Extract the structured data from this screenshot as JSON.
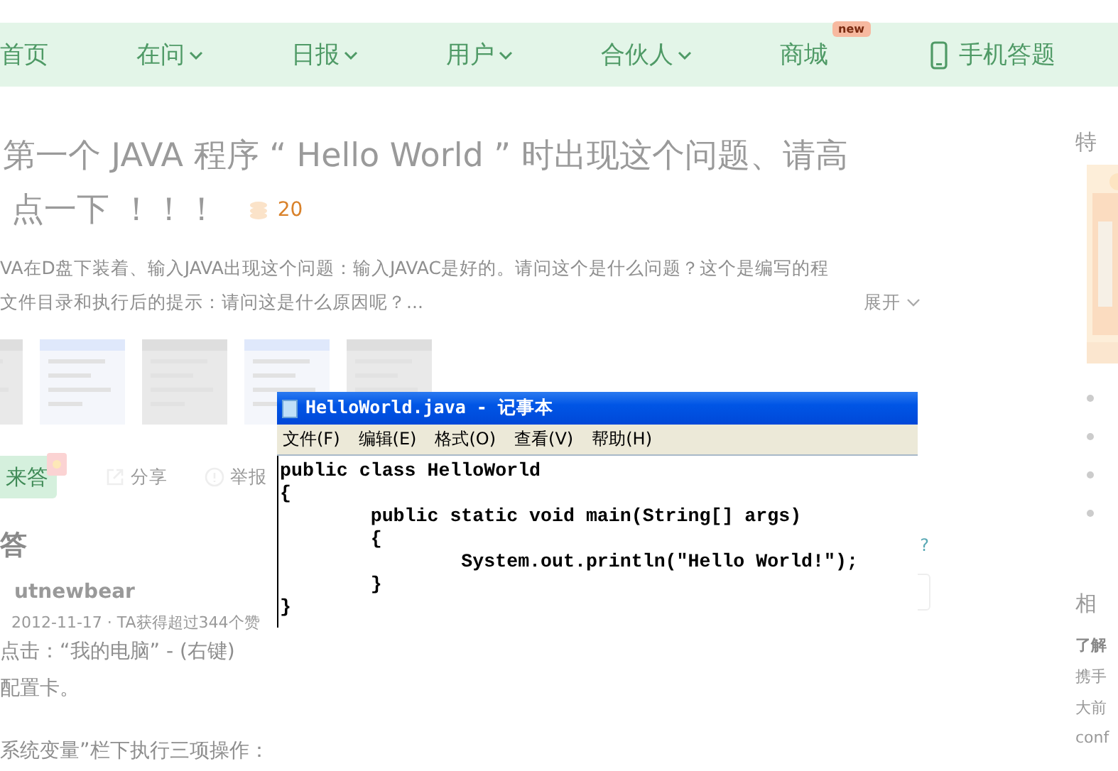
{
  "nav": {
    "items": [
      {
        "label": "首页",
        "kind": "link"
      },
      {
        "label": "在问",
        "kind": "dropdown"
      },
      {
        "label": "日报",
        "kind": "dropdown"
      },
      {
        "label": "用户",
        "kind": "dropdown"
      },
      {
        "label": "合伙人",
        "kind": "dropdown"
      },
      {
        "label": "商城",
        "kind": "badge",
        "badge": "new"
      },
      {
        "label": "手机答题",
        "kind": "app"
      }
    ]
  },
  "question": {
    "title_lines": [
      "第一个 JAVA 程序 “ Hello World ” 时出现这个问题、请高",
      "点一下 ！！！"
    ],
    "bounty": "20",
    "description_lines": [
      "VA在D盘下装着、输入JAVA出现这个问题：输入JAVAC是好的。请问这个是什么问题？这个是编写的程",
      "文件目录和执行后的提示：请问这是什么原因呢？..."
    ],
    "expand": "展开",
    "thumbnails": [
      {
        "kind": "picture"
      },
      {
        "kind": "picture"
      },
      {
        "kind": "picture"
      },
      {
        "kind": "picture"
      },
      {
        "kind": "picture"
      }
    ]
  },
  "actions": {
    "answer": "来答",
    "share": "分享",
    "report": "举报",
    "help": "?"
  },
  "answer": {
    "heading": "答",
    "author": "utnewbear",
    "meta": "2012-11-17 · TA获得超过344个赞",
    "body_lines": [
      "点击：“我的电脑” - (右键)",
      "配置卡。",
      "系统变量”栏下执行三项操作："
    ]
  },
  "sidebar": {
    "heading": "特",
    "bullets": [
      {
        "kind": "bullet"
      },
      {
        "kind": "bullet"
      },
      {
        "kind": "bullet"
      },
      {
        "kind": "bullet"
      }
    ],
    "related_heading": "相",
    "related": [
      "了解",
      "携手",
      "大前",
      "conf"
    ]
  },
  "notepad": {
    "title": "HelloWorld.java - 记事本",
    "menu": [
      "文件(F)",
      "编辑(E)",
      "格式(O)",
      "查看(V)",
      "帮助(H)"
    ],
    "code": [
      "public class HelloWorld",
      "{",
      "\tpublic static void main(String[] args)",
      "\t{",
      "\t\tSystem.out.println(\"Hello World!\");",
      "\t}",
      "}"
    ]
  }
}
